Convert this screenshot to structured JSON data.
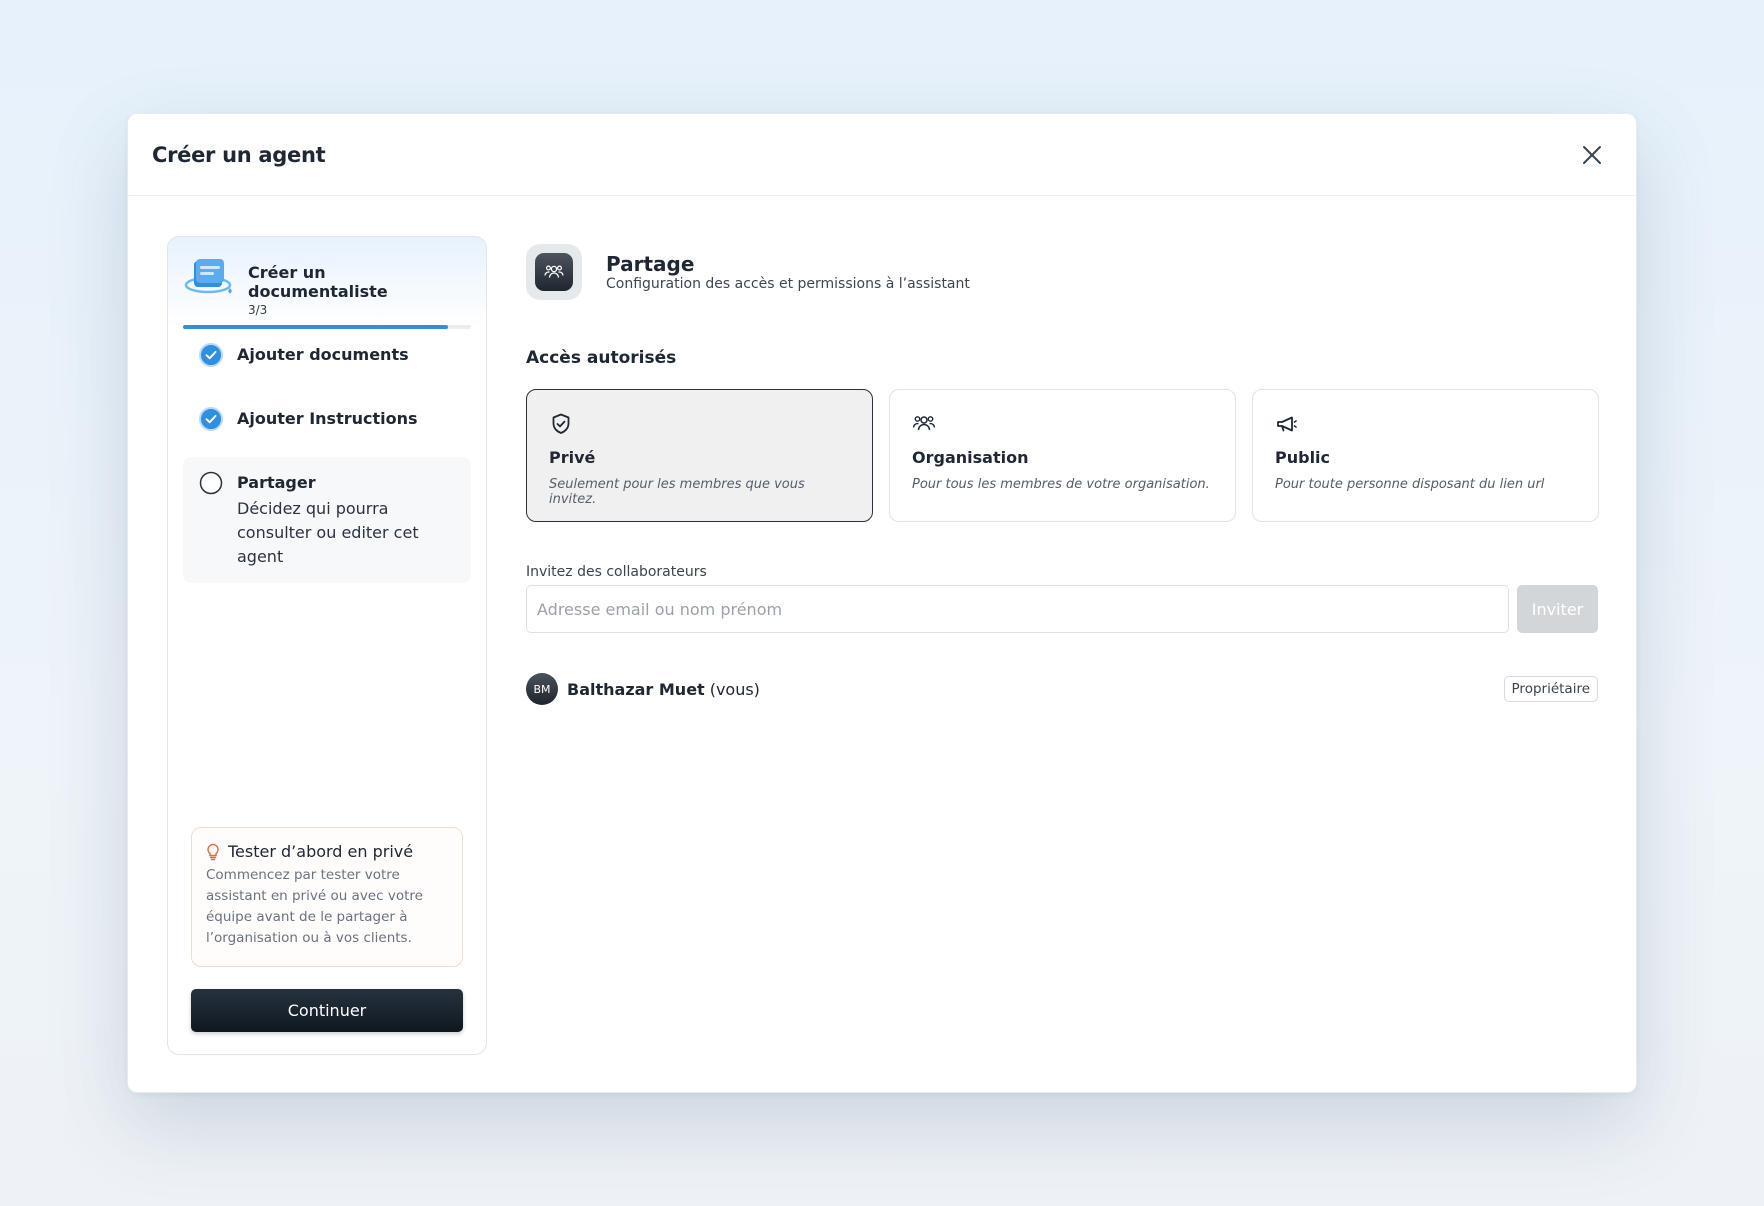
{
  "modal": {
    "title": "Créer un agent"
  },
  "stepper": {
    "title": "Créer un documentaliste",
    "count": "3/3",
    "progress": 0.92,
    "steps": [
      {
        "label": "Ajouter documents",
        "state": "done"
      },
      {
        "label": "Ajouter Instructions",
        "state": "done"
      },
      {
        "label": "Partager",
        "description": "Décidez qui pourra consulter ou editer cet agent",
        "state": "current"
      }
    ],
    "tip": {
      "title": "Tester d’abord en privé",
      "text": "Commencez par tester votre assistant en privé ou avec votre équipe avant de le partager à l’organisation ou à vos clients."
    },
    "continue_label": "Continuer"
  },
  "section": {
    "title": "Partage",
    "subtitle": "Configuration des accès et permissions à l’assistant",
    "icon": "users-icon"
  },
  "access": {
    "label": "Accès autorisés",
    "options": [
      {
        "title": "Privé",
        "description": "Seulement pour les membres que vous invitez.",
        "icon": "shield-check-icon",
        "selected": true
      },
      {
        "title": "Organisation",
        "description": "Pour tous les membres de votre organisation.",
        "icon": "users-icon",
        "selected": false
      },
      {
        "title": "Public",
        "description": "Pour toute personne disposant du lien url",
        "icon": "megaphone-icon",
        "selected": false
      }
    ]
  },
  "invite": {
    "label": "Invitez des collaborateurs",
    "placeholder": "Adresse email ou nom prénom",
    "button_label": "Inviter"
  },
  "members": [
    {
      "initials": "BM",
      "name": "Balthazar Muet",
      "suffix": "(vous)",
      "role": "Propriétaire"
    }
  ],
  "colors": {
    "accent": "#2f8fe0",
    "primary_button": "#0f1820",
    "disabled_button": "#d3d6d9"
  }
}
